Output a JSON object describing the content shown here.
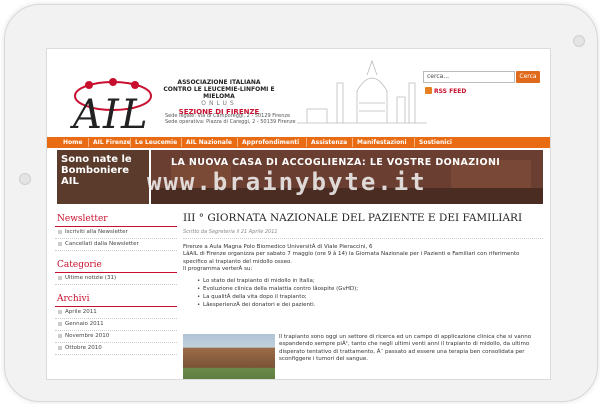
{
  "search": {
    "placeholder": "cerca...",
    "button_label": "Cerca"
  },
  "rss_label": "RSS FEED",
  "header": {
    "assoc_line1": "ASSOCIAZIONE ITALIANA",
    "assoc_line2": "CONTRO LE LEUCEMIE-LINFOMI E MIELOMA",
    "onlus": "ONLUS",
    "section": "SEZIONE DI FIRENZE",
    "addr1": "Sede legale: Via di Camporeggi, 2 - 50129 Firenze",
    "addr2": "Sede operativa: Piazza di Careggi, 2 - 50139 Firenze"
  },
  "nav": [
    "Home",
    "AIL Firenze",
    "Le Leucemie",
    "AIL Nazionale",
    "Approfondimenti",
    "Assistenza",
    "Manifestazioni",
    "Sostienici"
  ],
  "banner": {
    "left_text_1": "Sono nate le",
    "left_text_2": "Bomboniere",
    "left_text_3": "AIL",
    "right_text": "LA NUOVA CASA DI ACCOGLIENZA: LE VOSTRE DONAZIONI"
  },
  "watermark": "www.brainybyte.it",
  "sidebar": {
    "newsletter_title": "Newsletter",
    "newsletter_items": [
      "Iscriviti alla Newsletter",
      "Cancellati dalla Newsletter"
    ],
    "categories_title": "Categorie",
    "categories_items": [
      "Ultime notizie (31)"
    ],
    "archive_title": "Archivi",
    "archive_items": [
      "Aprile 2011",
      "Gennaio 2011",
      "Novembre 2010",
      "Ottobre 2010"
    ]
  },
  "article": {
    "title": "III   ° GIORNATA NAZIONALE DEL PAZIENTE E DEI FAMILIARI",
    "meta": "Scritto da Segreteria il 21 Aprile 2011",
    "intro1": "Firenze a Aula Magna Polo Biomedico UniversitÃ  di Viale Pieraccini, 6",
    "intro2": "LâAIL di Firenze organizza per sabato 7 maggio (ore 9 â 14) la Giornata Nazionale per i Pazienti e Familiari con riferimento specifico al trapianto del midollo osseo.",
    "intro3": "Il programma verterÃ  su:",
    "bullets": [
      "Lo stato del trapianto di midollo in Italia;",
      "Evoluzione clinica della malattia contro lâospite (GvHD);",
      "La qualitÃ  della vita dopo il trapianto;",
      "LâesperienzÃ  dei donatori e dei pazienti."
    ],
    "para2": "Il trapianto sono oggi un settore di ricerca ed un campo di applicazione clinica che si vanno espandendo sempre piÃ¹, tanto che negli ultimi venti anni il trapianto di midollo, da ultimo disperato tentativo di trattamento, Ã¨ passato ad essere una terapia ben consolidata per sconfiggere i tumori del sangue."
  },
  "colors": {
    "accent": "#e96b14",
    "brand_red": "#c8102e"
  }
}
